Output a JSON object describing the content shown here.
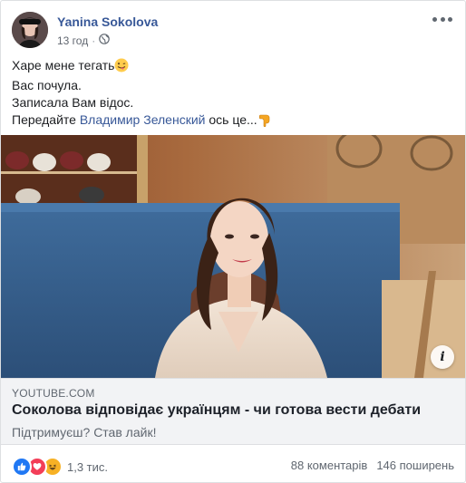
{
  "post": {
    "author": "Yanina Sokolova",
    "time": "13 год",
    "separator": "·",
    "privacy_icon": "globe-icon",
    "text_lines": {
      "l1": "Харе мене тегать",
      "l1_emoji": "winking-tongue-emoji",
      "l2": "Вас почула.",
      "l3": "Записала Вам відос.",
      "l4_pre": "Передайте",
      "l4_mention": "Владимир Зеленский",
      "l4_post": "ось це...",
      "l4_emoji": "pointing-down-hand-emoji"
    }
  },
  "link_preview": {
    "domain": "YOUTUBE.COM",
    "title": "Соколова відповідає українцям - чи готова вести дебати",
    "description": "Підтримуєш? Став лайк!",
    "info_label": "i"
  },
  "footer": {
    "reactions": [
      "like",
      "love",
      "haha"
    ],
    "reaction_count": "1,3 тис.",
    "comments": "88 коментарів",
    "shares": "146 поширень"
  },
  "colors": {
    "link_blue": "#385898",
    "like": "#2078f4",
    "love": "#f33e58",
    "haha": "#f7b125",
    "preview_bg": "#f2f3f5"
  }
}
